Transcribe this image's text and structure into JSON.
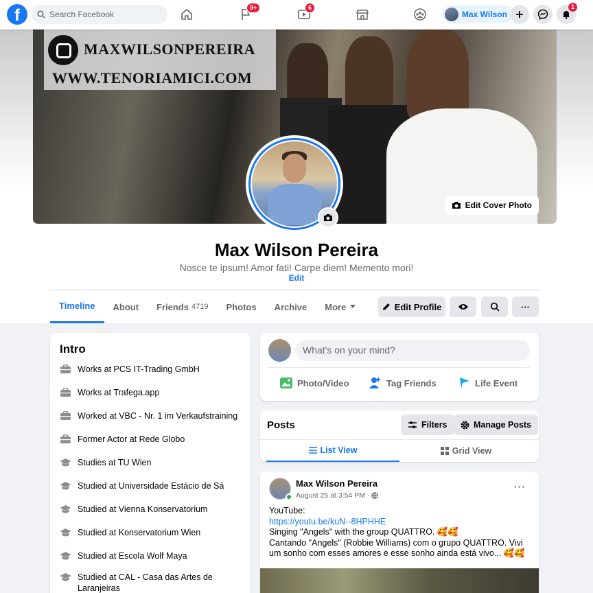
{
  "topbar": {
    "logo": "f",
    "search_placeholder": "Search Facebook",
    "badges": {
      "pages": "9+",
      "watch": "6",
      "notifications": "1"
    },
    "user_name": "Max Wilson"
  },
  "cover": {
    "line1": "MAXWILSONPEREIRA",
    "line2": "WWW.TENORIAMICI.COM",
    "edit_label": "Edit Cover Photo"
  },
  "profile": {
    "name": "Max Wilson Pereira",
    "bio": "Nosce te ipsum! Amor fati! Carpe diem! Memento mori!",
    "bio_edit": "Edit"
  },
  "tabs": {
    "timeline": "Timeline",
    "about": "About",
    "friends": "Friends",
    "friends_count": "4719",
    "photos": "Photos",
    "archive": "Archive",
    "more": "More"
  },
  "actions": {
    "edit_profile": "Edit Profile",
    "more_dots": "···"
  },
  "intro": {
    "title": "Intro",
    "items": [
      {
        "icon": "briefcase-icon",
        "text": "Works at PCS IT-Trading GmbH"
      },
      {
        "icon": "briefcase-icon",
        "text": "Works at Trafega.app"
      },
      {
        "icon": "briefcase-icon",
        "text": "Worked at VBC - Nr. 1 im Verkaufstraining"
      },
      {
        "icon": "briefcase-icon",
        "text": "Former Actor at Rede Globo"
      },
      {
        "icon": "graduation-cap-icon",
        "text": "Studies at TU Wien"
      },
      {
        "icon": "graduation-cap-icon",
        "text": "Studied at Universidade Estácio de Sá"
      },
      {
        "icon": "graduation-cap-icon",
        "text": "Studied at Vienna Konservatorium"
      },
      {
        "icon": "graduation-cap-icon",
        "text": "Studied at Konservatorium Wien"
      },
      {
        "icon": "graduation-cap-icon",
        "text": "Studied at Escola Wolf Maya"
      },
      {
        "icon": "graduation-cap-icon",
        "text": "Studied at CAL - Casa das Artes de Laranjeiras"
      }
    ]
  },
  "composer": {
    "placeholder": "What's on your mind?",
    "photo_video": "Photo/Video",
    "tag_friends": "Tag Friends",
    "life_event": "Life Event"
  },
  "posts_header": {
    "title": "Posts",
    "filters": "Filters",
    "manage": "Manage Posts",
    "list_view": "List View",
    "grid_view": "Grid View"
  },
  "post": {
    "author": "Max Wilson Pereira",
    "time": "August 25 at 3:54 PM ·",
    "more": "···",
    "line1": "YouTube:",
    "link": "https://youtu.be/kuN--8HPHHE",
    "line2": "Singing \"Angels\" with the group QUATTRO. 🥰🥰",
    "line3": "Cantando \"Angels\" (Robbie Williams) com o grupo QUATTRO. Vivi um sonho com esses amores e esse sonho ainda está vivo... 🥰🥰"
  },
  "colors": {
    "accent": "#1877f2",
    "badge": "#e41e3f",
    "background": "#f0f2f5"
  }
}
